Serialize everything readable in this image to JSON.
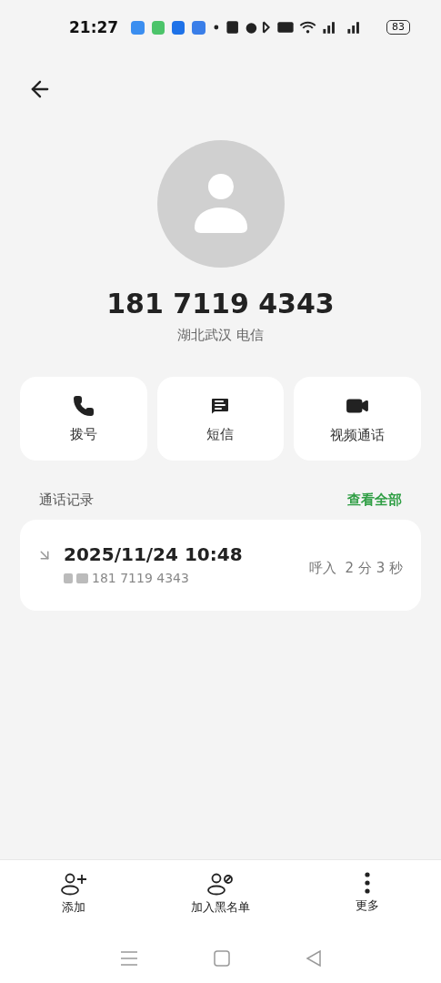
{
  "status_bar": {
    "time": "21:27",
    "battery": "83"
  },
  "contact": {
    "number": "181 7119 4343",
    "location": "湖北武汉 电信"
  },
  "actions": [
    {
      "kind": "call",
      "label": "拨号"
    },
    {
      "kind": "message",
      "label": "短信"
    },
    {
      "kind": "video",
      "label": "视频通话"
    }
  ],
  "call_log": {
    "title": "通话记录",
    "view_all": "查看全部",
    "entries": [
      {
        "kind": "incoming",
        "datetime": "2025/11/24 10:48",
        "number": "181 7119 4343",
        "summary": "呼入  2 分 3 秒"
      }
    ]
  },
  "bottom_bar": [
    {
      "kind": "add",
      "label": "添加"
    },
    {
      "kind": "block",
      "label": "加入黑名单"
    },
    {
      "kind": "more",
      "label": "更多"
    }
  ]
}
